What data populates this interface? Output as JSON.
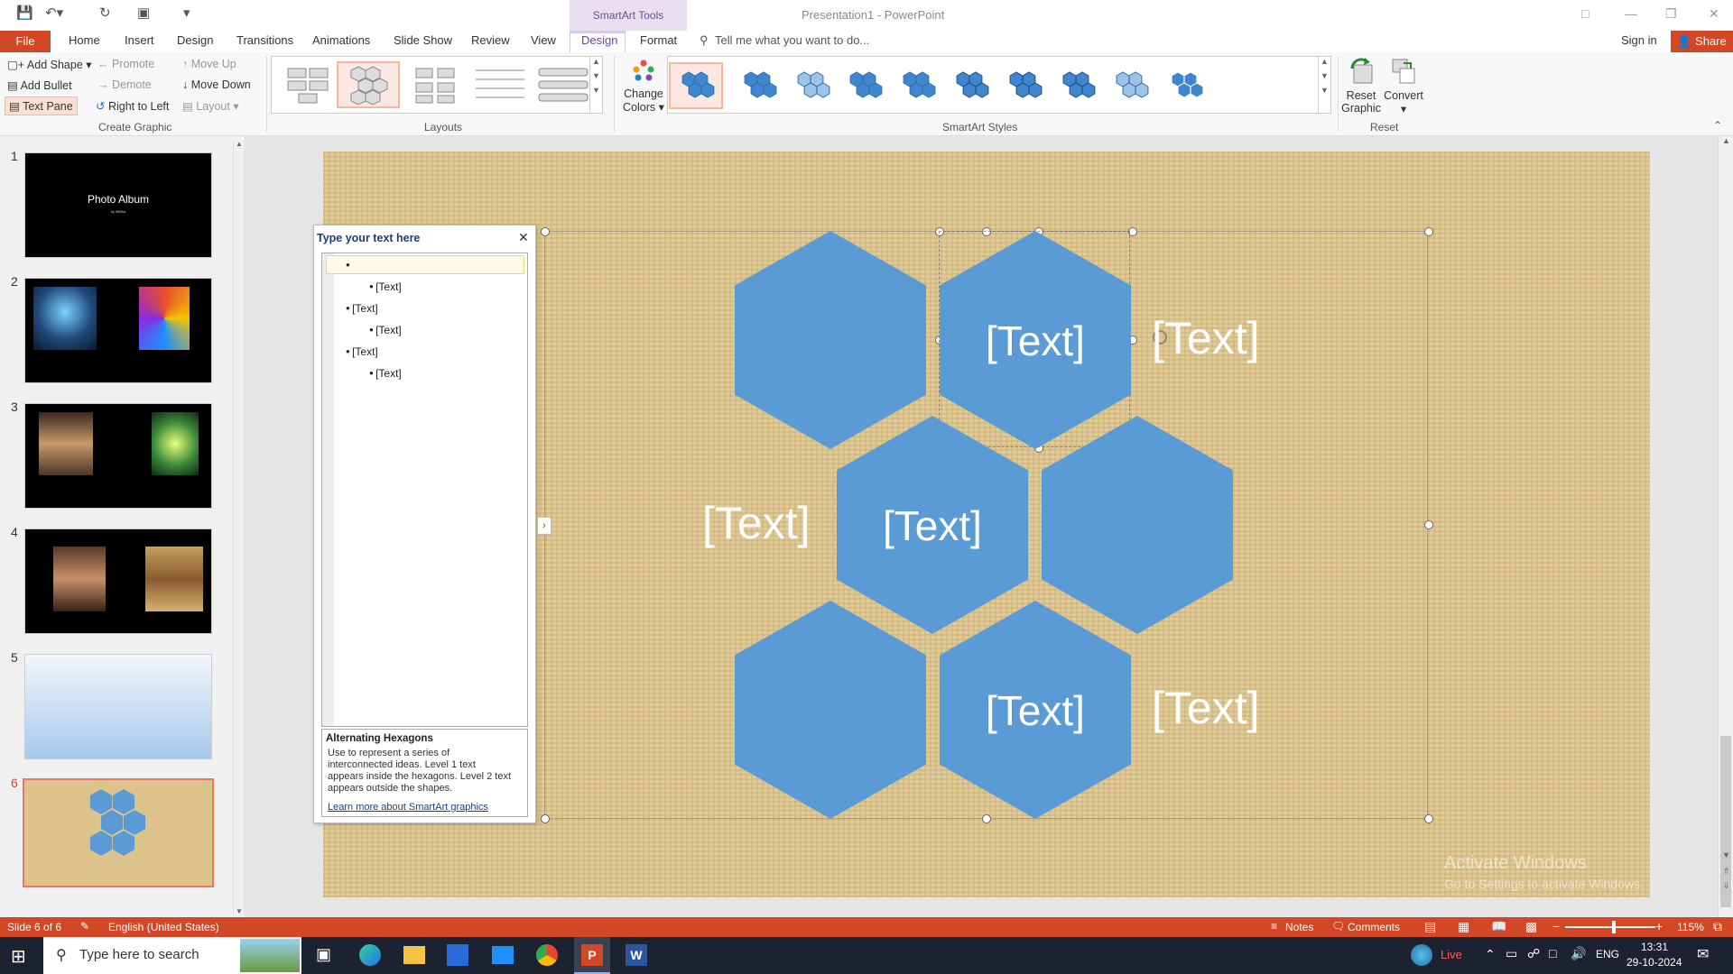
{
  "window": {
    "contextual_tab_group": "SmartArt Tools",
    "doc_title": "Presentation1 - PowerPoint"
  },
  "tabs": [
    "File",
    "Home",
    "Insert",
    "Design",
    "Transitions",
    "Animations",
    "Slide Show",
    "Review",
    "View",
    "Design",
    "Format"
  ],
  "tell_me": "Tell me what you want to do...",
  "sign_in": "Sign in",
  "share": "Share",
  "ribbon": {
    "create_graphic": {
      "add_shape": "Add Shape",
      "add_bullet": "Add Bullet",
      "text_pane": "Text Pane",
      "promote": "Promote",
      "demote": "Demote",
      "right_to_left": "Right to Left",
      "move_up": "Move Up",
      "move_down": "Move Down",
      "layout": "Layout",
      "label": "Create Graphic"
    },
    "layouts_label": "Layouts",
    "change_colors": [
      "Change",
      "Colors"
    ],
    "smartart_styles_label": "SmartArt Styles",
    "reset_graphic": [
      "Reset",
      "Graphic"
    ],
    "convert": "Convert",
    "reset_label": "Reset"
  },
  "thumbnails": [
    {
      "num": "1",
      "title": "Photo Album",
      "subtitle": "by Millika"
    },
    {
      "num": "2"
    },
    {
      "num": "3"
    },
    {
      "num": "4"
    },
    {
      "num": "5"
    },
    {
      "num": "6"
    }
  ],
  "text_pane": {
    "title": "Type your text here",
    "items": [
      {
        "level": 1,
        "text": ""
      },
      {
        "level": 2,
        "text": "[Text]"
      },
      {
        "level": 1,
        "text": "[Text]"
      },
      {
        "level": 2,
        "text": "[Text]"
      },
      {
        "level": 1,
        "text": "[Text]"
      },
      {
        "level": 2,
        "text": "[Text]"
      }
    ],
    "desc_title": "Alternating Hexagons",
    "desc_lines": [
      "Use to represent a series of",
      "interconnected ideas. Level 1 text",
      "appears inside the hexagons. Level 2 text",
      "appears outside the shapes."
    ],
    "learn_more": "Learn more about SmartArt graphics"
  },
  "smartart": {
    "hex_text": "[Text]",
    "hex_color": "#5b9bd5"
  },
  "watermark": {
    "line1": "Activate Windows",
    "line2": "Go to Settings to activate Windows."
  },
  "status": {
    "slide_info": "Slide 6 of 6",
    "language": "English (United States)",
    "notes": "Notes",
    "comments": "Comments",
    "zoom": "115%"
  },
  "taskbar": {
    "search_placeholder": "Type here to search",
    "live": "Live",
    "lang": "ENG",
    "time": "13:31",
    "date": "29-10-2024"
  },
  "colors": {
    "accent": "#d24726",
    "smartart_accent": "#6b4d8f"
  }
}
